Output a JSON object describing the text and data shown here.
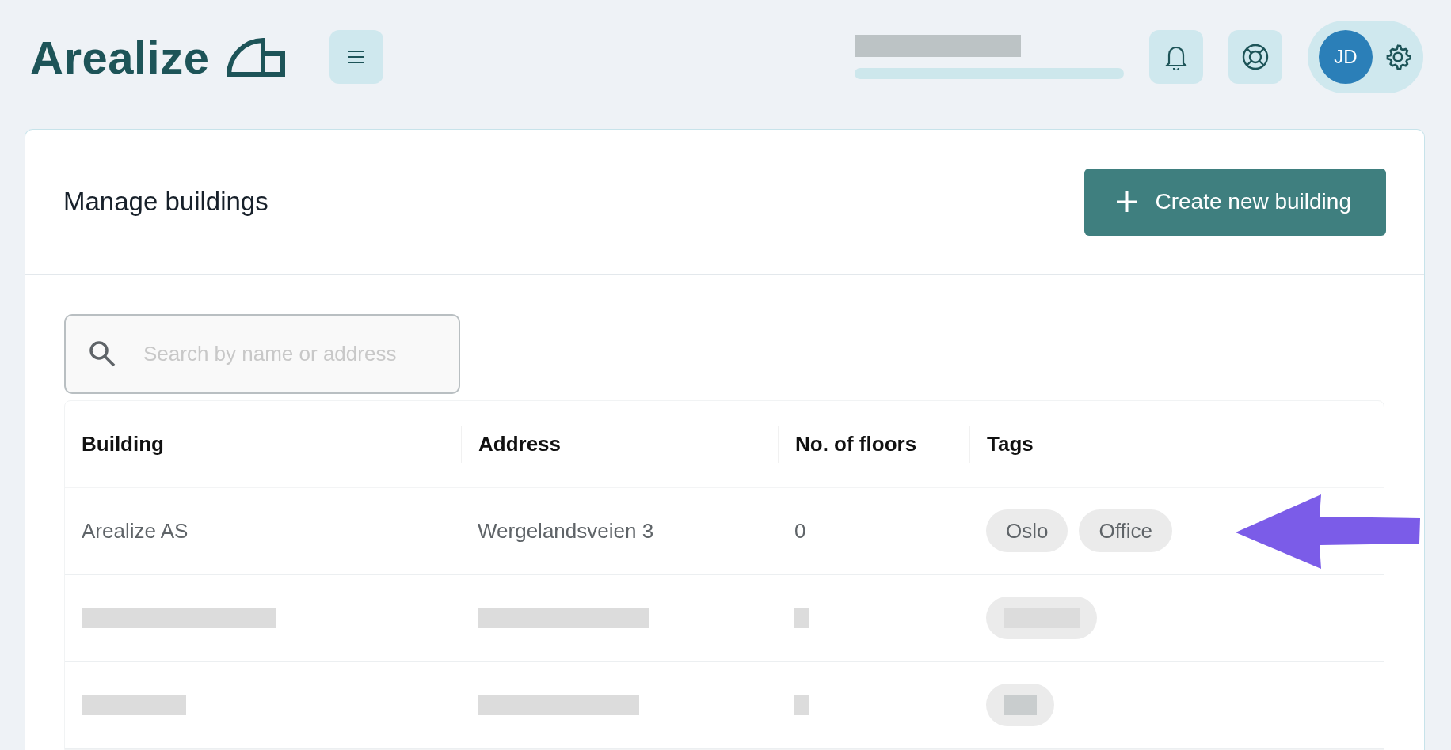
{
  "header": {
    "logo": "Arealize",
    "avatar_initials": "JD",
    "account_info": {
      "kind": "redacted"
    }
  },
  "page": {
    "title": "Manage buildings",
    "create_button": "Create new building"
  },
  "search": {
    "placeholder": "Search by name or address"
  },
  "table": {
    "columns": [
      "Building",
      "Address",
      "No. of floors",
      "Tags"
    ],
    "rows": [
      {
        "kind": "text",
        "building": "Arealize AS",
        "address": "Wergelandsveien 3",
        "floors": "0",
        "tags": [
          "Oslo",
          "Office"
        ]
      },
      {
        "kind": "redacted"
      },
      {
        "kind": "redacted"
      }
    ]
  },
  "annotation": {
    "kind": "arrow"
  }
}
